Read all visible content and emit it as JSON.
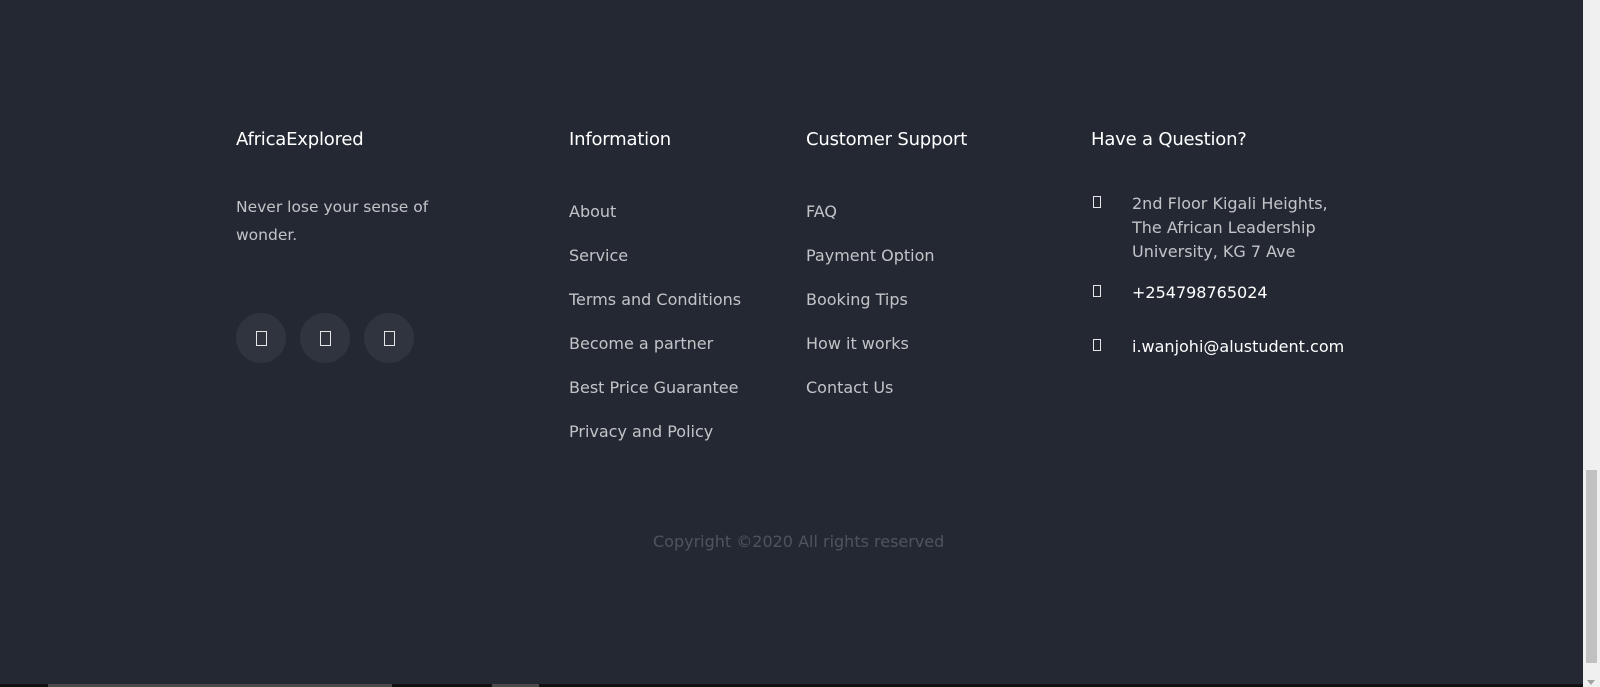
{
  "brand": {
    "title": "AfricaExplored",
    "tagline": "Never lose your sense of wonder.",
    "social_icons": [
      "twitter-icon",
      "facebook-icon",
      "instagram-icon"
    ]
  },
  "information": {
    "title": "Information",
    "links": [
      "About",
      "Service",
      "Terms and Conditions",
      "Become a partner",
      "Best Price Guarantee",
      "Privacy and Policy"
    ]
  },
  "support": {
    "title": "Customer Support",
    "links": [
      "FAQ",
      "Payment Option",
      "Booking Tips",
      "How it works",
      "Contact Us"
    ]
  },
  "question": {
    "title": "Have a Question?",
    "address": "2nd Floor Kigali Heights, The African Leadership University, KG 7 Ave",
    "phone": "+254798765024",
    "email": "i.wanjohi@alustudent.com"
  },
  "copyright": "Copyright ©2020 All rights reserved",
  "colors": {
    "background": "#232833",
    "heading": "#ffffff",
    "link": "#bdbfc2",
    "copyright": "#4a4e57"
  }
}
